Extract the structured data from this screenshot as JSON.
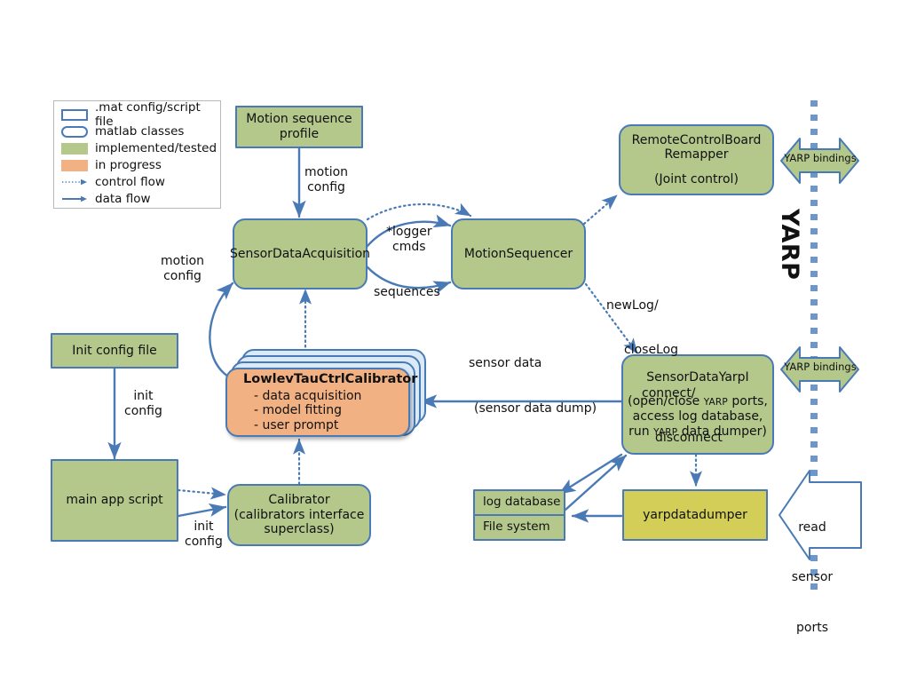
{
  "legend": {
    "title": "legend",
    "items": [
      {
        "swatch": "file-rect-icon",
        "label": ".mat config/script file"
      },
      {
        "swatch": "class-rect-icon",
        "label": "matlab classes"
      },
      {
        "swatch": "green-fill-icon",
        "label": "implemented/tested"
      },
      {
        "swatch": "orange-fill-icon",
        "label": "in progress"
      },
      {
        "swatch": "dotted-arrow-icon",
        "label": "control flow"
      },
      {
        "swatch": "solid-arrow-icon",
        "label": "data flow"
      }
    ]
  },
  "colors": {
    "green": "#b4c88c",
    "orange": "#f2b183",
    "yellow": "#d3ce57",
    "stack_fill": "#dbeaf7",
    "border_blue": "#4a7ab5",
    "arrow_blue": "#4a7ab5",
    "white": "#ffffff"
  },
  "nodes": {
    "motion_sequence_profile": {
      "title": "Motion sequence\nprofile",
      "style": "green-sharp"
    },
    "sensor_data_acquisition": {
      "title": "SensorDataAcquisition",
      "style": "green-round"
    },
    "motion_sequencer": {
      "title": "MotionSequencer",
      "style": "green-round"
    },
    "remote_control_board_remapper": {
      "title": "RemoteControlBoard\nRemapper",
      "subtitle": "(Joint control)",
      "style": "green-round"
    },
    "init_config_file": {
      "title": "Init config file",
      "style": "green-sharp"
    },
    "main_app_script": {
      "title": "main app script",
      "style": "green-sharp"
    },
    "calibrator_superclass": {
      "title": "Calibrator",
      "subtitle": "(calibrators interface\nsuperclass)",
      "style": "green-round"
    },
    "lowlev_tau_ctrl_calibrator": {
      "title": "LowlevTauCtrlCalibrator",
      "bullets": [
        "-  data acquisition",
        "-  model fitting",
        "-  user prompt"
      ],
      "style": "orange-round-stacked"
    },
    "sensor_data_yarpi": {
      "title": "SensorDataYarpI",
      "lines": [
        {
          "pre": "(open/close ",
          "sc": "YARP",
          "post": " ports,"
        },
        {
          "pre": "access log database,",
          "sc": "",
          "post": ""
        },
        {
          "pre": "run ",
          "sc": "YARP",
          "post": " data dumper)"
        }
      ],
      "style": "green-round"
    },
    "log_database": {
      "title": "log database",
      "style": "green-sharp-split-top"
    },
    "file_system": {
      "title": "File system",
      "style": "green-sharp-split-bottom"
    },
    "yarpdatadumper": {
      "title": "yarpdatadumper",
      "style": "yellow-sharp"
    }
  },
  "edge_labels": {
    "motion_config_top": "motion\nconfig",
    "motion_config_left": "motion\nconfig",
    "logger_cmds": "*logger\ncmds",
    "sequences": "sequences",
    "newlog_closelog": "newLog/\n  closeLog\n    connect/\n      disconnect",
    "newlog_lines": [
      "newLog/",
      "closeLog",
      "connect/",
      "disconnect"
    ],
    "sensor_data": "sensor data",
    "sensor_data_dump": "(sensor data dump)",
    "init_config_upper": "init\nconfig",
    "init_config_lower": "init\nconfig"
  },
  "yarp": {
    "spine_label": "YARP",
    "binding_top": "YARP bindings",
    "binding_mid": "YARP bindings",
    "read_sensor_ports": "read\nsensor\nports",
    "read_sensor_ports_lines": [
      "read",
      "sensor",
      "ports"
    ]
  }
}
